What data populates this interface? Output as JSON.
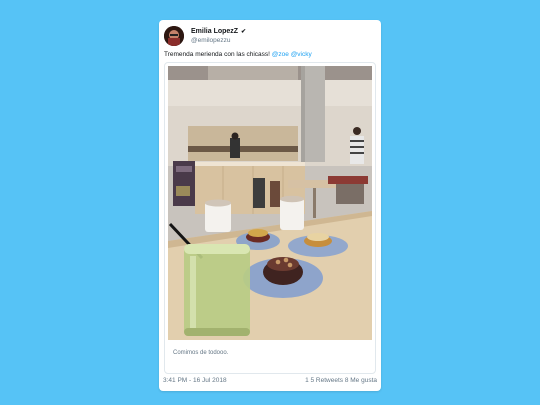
{
  "tweet": {
    "display_name": "Emilia LopezZ",
    "verified_mark": "✔",
    "handle": "@emilopezzu",
    "text_prefix": "Tremenda merienda con las chicass! ",
    "mention_1": "@zoe",
    "mention_2": "@vicky",
    "caption": "Comimos de todooo.",
    "timestamp": "3:41 PM - 16 Jul 2018",
    "stats": "1 5 Retweets 8 Me gusta"
  },
  "colors": {
    "background": "#56c3f6",
    "mention": "#1da1f2",
    "text": "#14171a",
    "secondary_text": "#657786"
  },
  "icons": {
    "verified": "checkmark-icon"
  }
}
